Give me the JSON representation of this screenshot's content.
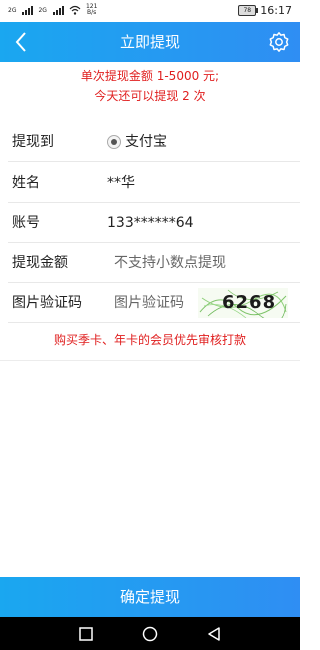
{
  "status_bar": {
    "signal1_label": "2G",
    "signal2_label": "2G",
    "net_speed": "121\nB/s",
    "net_speed_top": "121",
    "net_speed_bottom": "B/s",
    "battery": "78",
    "time": "16:17"
  },
  "nav": {
    "title": "立即提现",
    "back_icon": "chevron-left-icon",
    "settings_icon": "gear-icon"
  },
  "notice": {
    "line1": "单次提现金额 1-5000 元;",
    "line2": "今天还可以提现 2 次"
  },
  "form": {
    "withdraw_to_label": "提现到",
    "withdraw_to_option": "支付宝",
    "name_label": "姓名",
    "name_value": "**华",
    "account_label": "账号",
    "account_value": "133******64",
    "amount_label": "提现金额",
    "amount_placeholder": "不支持小数点提现",
    "captcha_label": "图片验证码",
    "captcha_placeholder": "图片验证码",
    "captcha_text": "6268"
  },
  "promo": "购买季卡、年卡的会员优先审核打款",
  "confirm_button": "确定提现",
  "colors": {
    "accent": "#1aa7f0",
    "accent2": "#2f8ef3",
    "warning": "#e02020"
  }
}
